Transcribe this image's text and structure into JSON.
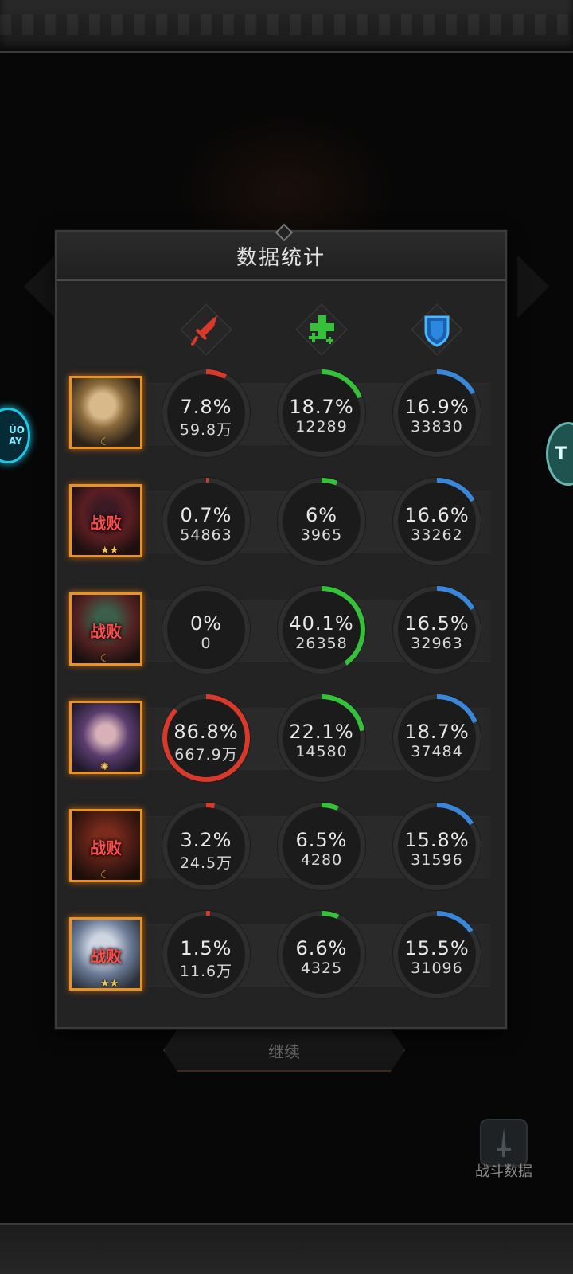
{
  "panel": {
    "title": "数据统计",
    "columns": [
      {
        "icon": "damage-sword-icon",
        "color": "#d8392b"
      },
      {
        "icon": "heal-cross-icon",
        "color": "#35c23a"
      },
      {
        "icon": "shield-icon",
        "color": "#3a86d8"
      }
    ],
    "rows": [
      {
        "defeated_label": "",
        "badge": "☾",
        "portrait": "blonde-hero-portrait",
        "damage": {
          "pct": "7.8%",
          "value": "59.8万",
          "fraction": 0.078
        },
        "heal": {
          "pct": "18.7%",
          "value": "12289",
          "fraction": 0.187
        },
        "shield": {
          "pct": "16.9%",
          "value": "33830",
          "fraction": 0.169
        }
      },
      {
        "defeated_label": "战败",
        "badge": "★★",
        "portrait": "dark-knight-portrait",
        "damage": {
          "pct": "0.7%",
          "value": "54863",
          "fraction": 0.007
        },
        "heal": {
          "pct": "6%",
          "value": "3965",
          "fraction": 0.06
        },
        "shield": {
          "pct": "16.6%",
          "value": "33262",
          "fraction": 0.166
        }
      },
      {
        "defeated_label": "战败",
        "badge": "☾",
        "portrait": "antler-hero-portrait",
        "damage": {
          "pct": "0%",
          "value": "0",
          "fraction": 0
        },
        "heal": {
          "pct": "40.1%",
          "value": "26358",
          "fraction": 0.401
        },
        "shield": {
          "pct": "16.5%",
          "value": "32963",
          "fraction": 0.165
        }
      },
      {
        "defeated_label": "",
        "badge": "✺",
        "portrait": "purple-sorceress-portrait",
        "damage": {
          "pct": "86.8%",
          "value": "667.9万",
          "fraction": 0.868
        },
        "heal": {
          "pct": "22.1%",
          "value": "14580",
          "fraction": 0.221
        },
        "shield": {
          "pct": "18.7%",
          "value": "37484",
          "fraction": 0.187
        }
      },
      {
        "defeated_label": "战败",
        "badge": "☾",
        "portrait": "red-hair-hero-portrait",
        "damage": {
          "pct": "3.2%",
          "value": "24.5万",
          "fraction": 0.032
        },
        "heal": {
          "pct": "6.5%",
          "value": "4280",
          "fraction": 0.065
        },
        "shield": {
          "pct": "15.8%",
          "value": "31596",
          "fraction": 0.158
        }
      },
      {
        "defeated_label": "战败",
        "badge": "★★",
        "portrait": "silver-hair-hero-portrait",
        "damage": {
          "pct": "1.5%",
          "value": "11.6万",
          "fraction": 0.015
        },
        "heal": {
          "pct": "6.6%",
          "value": "4325",
          "fraction": 0.066
        },
        "shield": {
          "pct": "15.5%",
          "value": "31096",
          "fraction": 0.155
        }
      }
    ]
  },
  "background": {
    "continue_label": "继续",
    "battle_data_label": "战斗数据",
    "left_badge_text": "ÚO\nAY",
    "right_badge_text": "T"
  }
}
